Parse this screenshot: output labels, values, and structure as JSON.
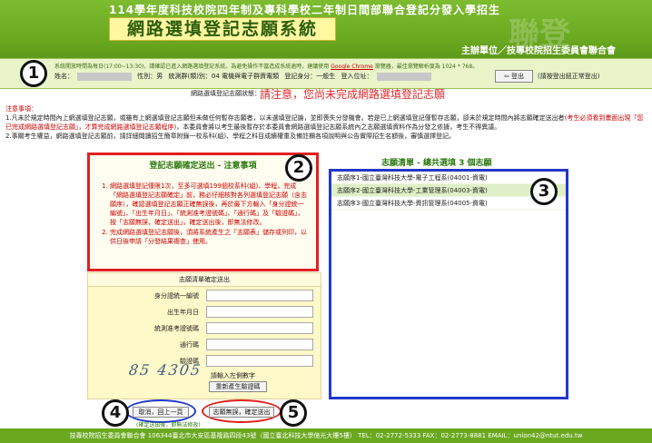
{
  "header": {
    "top_line": "114學年度科技校院四年制及專科學校二年制日間部聯合登記分發入學招生",
    "title": "網路選填登記志願系統",
    "watermark": "聯登",
    "org": "主辦單位／技專校院招生委員會聯合會"
  },
  "info_bar": {
    "notice": "系統開放時間為每日(17:00~13:30)，請確認已進入網路選填登記系統。為避免操作不當造成系統逾時，建議使用",
    "chrome_link": "Google Chrome",
    "notice_tail": "瀏覽器，最佳瀏覽解析度為 1024 * 768。",
    "name_label": "姓名：",
    "gender": "性別：男",
    "group": "統測群(類)別：04 電機與電子群資電類",
    "identity": "登記身分：一般生",
    "login_ip_label": "登入位址：",
    "logout_button": "登出",
    "logout_hint": "(請按登出鈕正常登出)"
  },
  "status": {
    "label": "網路選填登記志願狀態：",
    "warning": "請注意，您尚未完成網路選填登記志願"
  },
  "notes": {
    "title": "注意事項：",
    "item1_a": "1.凡未於規定時間內上網選填登記志願，或雖有上網選填登記志願但未做任何暫存志願者，以未選填登記論，並即喪失分發機會。若是已上網選填登記僅暫存志願，卻未於規定時間內將志願確定送出者",
    "item1_red": "(考生必須看到畫面出現「您已完成網路選填登記志願」，才算完成網路選填登記志願程序)",
    "item1_b": "，本委員會將以考生最後暫存於本委員會網路選填登記志願系統內之志願選填資料作為分發之依據，考生不得異議。",
    "item2": "2.事關考生權益，網路選填登記志願前，請詳細閱讀招生簡章附錄一校系科(組)、學程之科目成績權重及備註欄各項說明與公告實際招生名額後，審慎選擇登記。"
  },
  "markers": [
    "1",
    "2",
    "3",
    "4",
    "5"
  ],
  "confirm_box": {
    "title": "登記志願確定送出 - 注意事項",
    "item1": "網路選填登記僅限1次，至多可選填199個校系科(組)、學程，完成「網路選填登記志願確定」前，務必仔細核對各列選填登記志願（含志願序），確認選填登記志願正確無誤後，再於最下方輸入「身分證統一編號」、「出生年月日」、「統測准考證號碼」、「通行碼」及「驗證碼」，按「志願無誤，確定送出」，確定送出後，即無法修改。",
    "item2": "完成網路選填登記志願後，須將系統產生之「志願表」儲存或列印，以供日後申請「分發結果複查」使用。"
  },
  "wish_list": {
    "title": "志願清單 - 總共選填 3 個志願",
    "items": [
      "志願序1-國立臺灣科技大學-電子工程系(04001-資電)",
      "志願序2-國立臺灣科技大學-工業管理系(04003-資電)",
      "志願序3-國立臺灣科技大學-資訊管理系(04005-資電)"
    ]
  },
  "confirm_form": {
    "head": "志願清單確定送出",
    "id_label": "身分證統一編號",
    "birth_label": "出生年月日",
    "exam_label": "統測准考證號碼",
    "pass_label": "通行碼",
    "captcha_label": "驗證碼",
    "captcha_text": "85 4305",
    "captcha_hint": "請輸入左側數字",
    "captcha_refresh": "重新產生驗證碼"
  },
  "actions": {
    "cancel": "取消，回上一頁",
    "submit": "志願無誤，確定送出",
    "under_note": "(確定送出後，即無法修改)"
  },
  "footer": {
    "text": "技專校院招生委員會聯合會 106344臺北市大安區基隆路四段43號（國立臺北科技大學億光大樓5樓） TEL：02-2772-5333 FAX：02-2773-8881 EMAIL：union42@ntut.edu.tw"
  }
}
